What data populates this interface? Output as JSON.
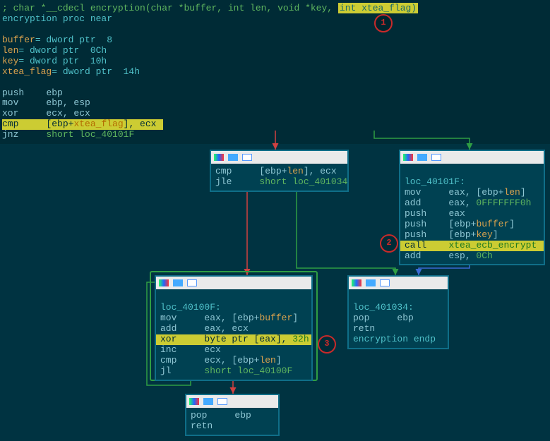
{
  "top": {
    "sig_prefix": "; char *__cdecl encryption(char *buffer, int len, void *key, ",
    "sig_hl_param": "int xtea_flag)",
    "proc_line": "encryption proc near",
    "vars": [
      {
        "name": "buffer",
        "rest": "= dword ptr  8"
      },
      {
        "name": "len",
        "rest": "= dword ptr  0Ch"
      },
      {
        "name": "key",
        "rest": "= dword ptr  10h"
      },
      {
        "name": "xtea_flag",
        "rest": "= dword ptr  14h"
      }
    ],
    "ins": [
      {
        "op": "push",
        "args": "ebp"
      },
      {
        "op": "mov",
        "args": "ebp, esp"
      },
      {
        "op": "xor",
        "args": "ecx, ecx"
      }
    ],
    "cmp_line": {
      "op": "cmp",
      "arg1_pre": "[ebp+",
      "var": "xtea_flag",
      "arg1_post": "], ecx"
    },
    "jnz_line": {
      "op": "jnz",
      "target": "short loc_40101F"
    }
  },
  "node2": {
    "l1": {
      "op": "cmp",
      "pre": "[ebp+",
      "var": "len",
      "post": "], ecx"
    },
    "l2": {
      "op": "jle",
      "target": "short loc_401034"
    }
  },
  "node3": {
    "label": "loc_40101F:",
    "l1": {
      "op": "mov",
      "args": "eax, [ebp+",
      "var": "len",
      "post": "]"
    },
    "l2": {
      "op": "add",
      "args": "eax, 0FFFFFFF0h"
    },
    "l3": {
      "op": "push",
      "args": "eax"
    },
    "l4": {
      "op": "push",
      "pre": "[ebp+",
      "var": "buffer",
      "post": "]"
    },
    "l5": {
      "op": "push",
      "pre": "[ebp+",
      "var": "key",
      "post": "]"
    },
    "l6": {
      "op": "call",
      "target": "xtea_ecb_encrypt"
    },
    "l7": {
      "op": "add",
      "args": "esp, 0Ch"
    }
  },
  "node4": {
    "label": "loc_40100F:",
    "l1": {
      "op": "mov",
      "args": "eax, [ebp+",
      "var": "buffer",
      "post": "]"
    },
    "l2": {
      "op": "add",
      "args": "eax, ecx"
    },
    "l3": {
      "op": "xor",
      "args": "byte ptr [eax], 32h"
    },
    "l4": {
      "op": "inc",
      "args": "ecx"
    },
    "l5": {
      "op": "cmp",
      "args": "ecx, [ebp+",
      "var": "len",
      "post": "]"
    },
    "l6": {
      "op": "jl",
      "target": "short loc_40100F"
    }
  },
  "node5": {
    "label": "loc_401034:",
    "l1": {
      "op": "pop",
      "args": "ebp"
    },
    "l2": {
      "op": "retn",
      "args": ""
    },
    "l3": "encryption endp"
  },
  "node6": {
    "l1": {
      "op": "pop",
      "args": "ebp"
    },
    "l2": {
      "op": "retn",
      "args": ""
    }
  },
  "badges": {
    "b1": "1",
    "b2": "2",
    "b3": "3"
  }
}
